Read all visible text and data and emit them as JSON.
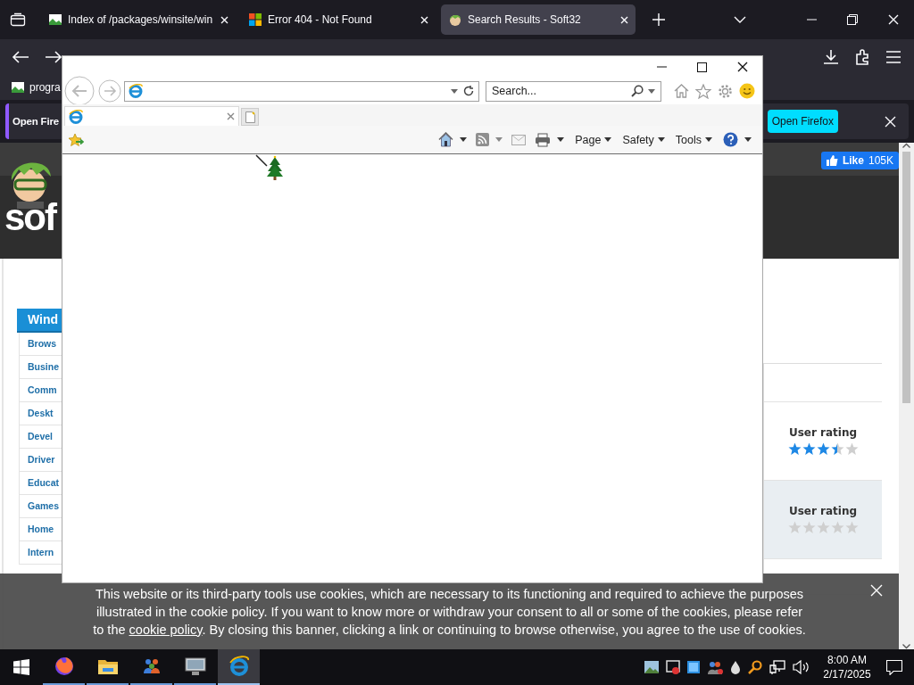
{
  "firefox": {
    "tabs": [
      {
        "kind": "image",
        "title": "Index of /packages/winsite/win",
        "selected": false
      },
      {
        "kind": "tiles",
        "title": "Error 404 - Not Found",
        "selected": false
      },
      {
        "kind": "mascot",
        "title": "Search Results - Soft32",
        "selected": true
      }
    ],
    "bookmarks": [
      {
        "label": "progra"
      }
    ],
    "notification": {
      "text": "Open Fire",
      "button": "Open Firefox"
    }
  },
  "page": {
    "logo_text": "sof",
    "like": {
      "label": "Like",
      "count": "105K"
    },
    "sidebar": {
      "heading": "Wind",
      "items": [
        "Brows",
        "Busine",
        "Comm",
        "Deskt",
        "Devel",
        "Driver",
        "Educat",
        "Games",
        "Home",
        "Intern"
      ]
    },
    "ratings": [
      {
        "label": "User rating",
        "stars": 3.5
      },
      {
        "label": "User rating",
        "stars": 0
      }
    ]
  },
  "cookie_banner": {
    "text_before": "This website or its third-party tools use cookies, which are necessary to its functioning and required to achieve the purposes illustrated in the cookie policy. If you want to know more or withdraw your consent to all or some of the cookies, please refer to the ",
    "link": "cookie policy",
    "text_after": ". By closing this banner, clicking a link or continuing to browse otherwise, you agree to the use of cookies."
  },
  "ie_window": {
    "search": {
      "placeholder": "Search..."
    },
    "commands": [
      "Page",
      "Safety",
      "Tools"
    ]
  },
  "taskbar": {
    "apps": [
      {
        "kind": "firefox",
        "selected": false
      },
      {
        "kind": "folder",
        "selected": false
      },
      {
        "kind": "people",
        "selected": false
      },
      {
        "kind": "monitor",
        "selected": false
      },
      {
        "kind": "ie",
        "selected": true
      }
    ],
    "time": "8:00 AM",
    "date": "2/17/2025"
  }
}
